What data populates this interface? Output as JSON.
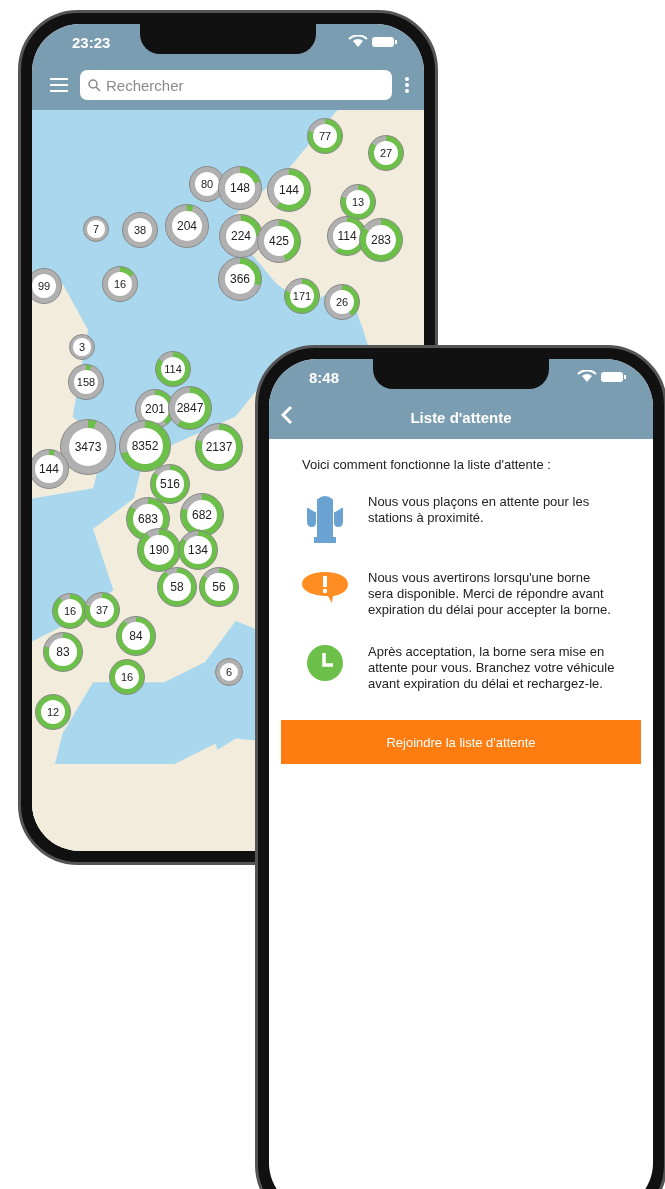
{
  "map_phone": {
    "status_time": "23:23",
    "search": {
      "placeholder": "Rechercher"
    },
    "clusters": [
      {
        "count": "77"
      },
      {
        "count": "27"
      },
      {
        "count": "80"
      },
      {
        "count": "148"
      },
      {
        "count": "144"
      },
      {
        "count": "13"
      },
      {
        "count": "7"
      },
      {
        "count": "38"
      },
      {
        "count": "204"
      },
      {
        "count": "224"
      },
      {
        "count": "425"
      },
      {
        "count": "114"
      },
      {
        "count": "283"
      },
      {
        "count": "99"
      },
      {
        "count": "16"
      },
      {
        "count": "366"
      },
      {
        "count": "171"
      },
      {
        "count": "26"
      },
      {
        "count": "3"
      },
      {
        "count": "158"
      },
      {
        "count": "114"
      },
      {
        "count": "201"
      },
      {
        "count": "2847"
      },
      {
        "count": "3473"
      },
      {
        "count": "144"
      },
      {
        "count": "8352"
      },
      {
        "count": "2137"
      },
      {
        "count": "516"
      },
      {
        "count": "683"
      },
      {
        "count": "682"
      },
      {
        "count": "190"
      },
      {
        "count": "134"
      },
      {
        "count": "58"
      },
      {
        "count": "56"
      },
      {
        "count": "16"
      },
      {
        "count": "37"
      },
      {
        "count": "84"
      },
      {
        "count": "83"
      },
      {
        "count": "16"
      },
      {
        "count": "6"
      },
      {
        "count": "12"
      }
    ]
  },
  "waitlist_phone": {
    "status_time": "8:48",
    "title": "Liste d'attente",
    "intro": "Voici comment fonctionne la liste d'attente :",
    "steps": [
      {
        "kind": "station",
        "text": "Nous vous plaçons en attente pour les stations à proximité."
      },
      {
        "kind": "alert",
        "text": "Nous vous avertirons lorsqu'une borne sera disponible. Merci de répondre avant expiration du délai pour accepter la borne."
      },
      {
        "kind": "clock",
        "text": "Après acceptation, la borne sera mise en attente pour vous. Branchez votre véhicule avant expiration du délai et rechargez-le."
      }
    ],
    "button": "Rejoindre la liste d'attente"
  }
}
